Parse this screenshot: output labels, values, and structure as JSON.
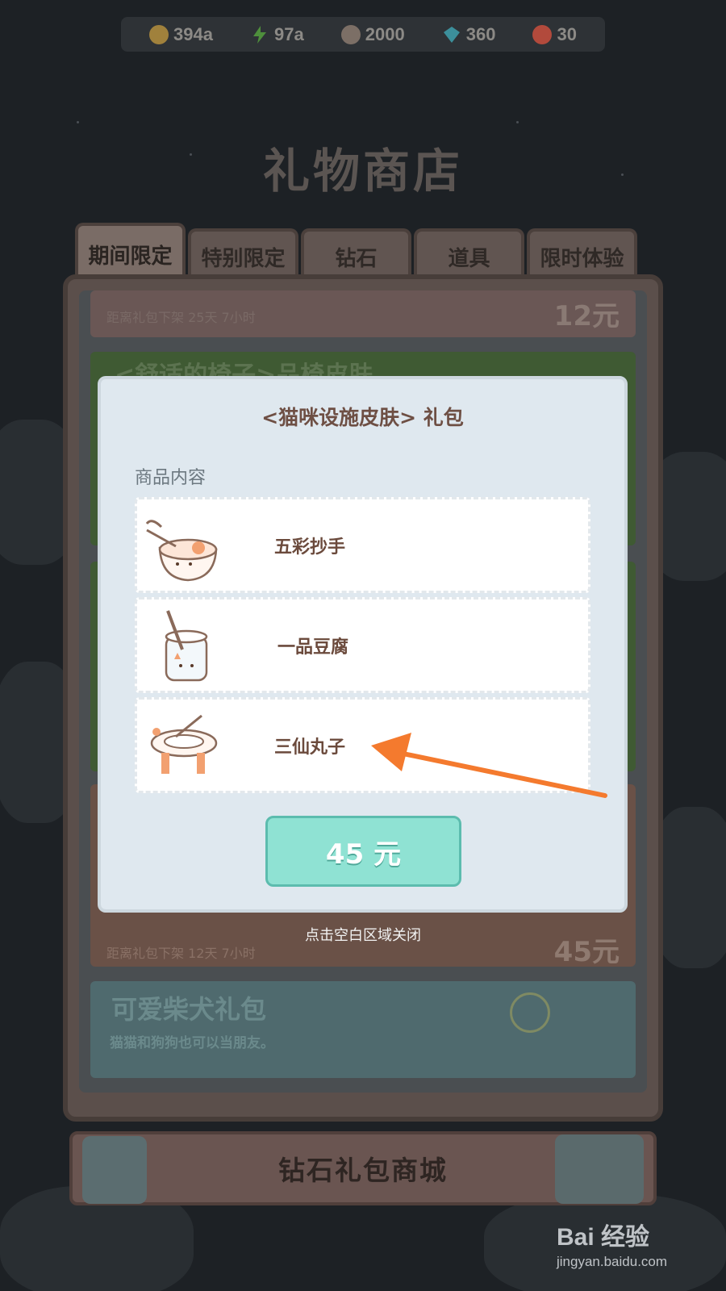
{
  "resources": [
    {
      "icon": "gold-coin-icon",
      "value": "394a",
      "color": "#a0813c"
    },
    {
      "icon": "lightning-icon",
      "value": "97a",
      "color": "#4e8f3c"
    },
    {
      "icon": "can-icon",
      "value": "2000",
      "color": "#7c6f66"
    },
    {
      "icon": "diamond-icon",
      "value": "360",
      "color": "#3c8f9b"
    },
    {
      "icon": "ticket-icon",
      "value": "30",
      "color": "#b24a3c"
    }
  ],
  "shop": {
    "title": "礼物商店",
    "tabs": [
      "期间限定",
      "特别限定",
      "钻石",
      "道具",
      "限时体验"
    ],
    "active_tab": 0,
    "cards": [
      {
        "timer": "距离礼包下架 25天 7小时",
        "price": "12元"
      },
      {
        "title": "<舒适的椅子>品椅皮肤"
      },
      {
        "timer": "距离礼包下架 12天 7小时",
        "price": "45元"
      },
      {
        "title": "可爱柴犬礼包",
        "desc": "猫猫和狗狗也可以当朋友。"
      }
    ],
    "diamond_store_label": "钻石礼包商城"
  },
  "modal": {
    "title": "<猫咪设施皮肤> 礼包",
    "subtitle": "商品内容",
    "items": [
      {
        "name": "五彩抄手",
        "icon": "bowl-cat-icon"
      },
      {
        "name": "一品豆腐",
        "icon": "cup-cat-icon"
      },
      {
        "name": "三仙丸子",
        "icon": "plate-stand-icon"
      }
    ],
    "price_label": "45 元",
    "close_hint": "点击空白区域关闭"
  },
  "annotation": {
    "arrow_color": "#f47a2e"
  },
  "watermark": {
    "logo": "Bai 经验",
    "url": "jingyan.baidu.com"
  }
}
